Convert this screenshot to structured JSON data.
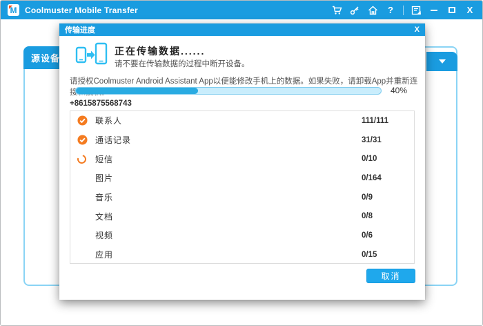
{
  "titlebar": {
    "logo_letter": "M",
    "app_title": "Coolmuster Mobile Transfer",
    "help_glyph": "?",
    "close_glyph": "X"
  },
  "background": {
    "source_device_label": "源设备："
  },
  "dialog": {
    "title": "传输进度",
    "close_glyph": "X",
    "heading": "正在传输数据......",
    "warning": "请不要在传输数据的过程中断开设备。",
    "auth_note": "请授权Coolmuster Android Assistant App以便能修改手机上的数据。如果失败，请卸载App并重新连接和授权。",
    "progress_percent": 40,
    "progress_label": "40%",
    "device_number": "+8615875568743",
    "transfer_items": [
      {
        "label": "联系人",
        "count": "111/111",
        "status": "done"
      },
      {
        "label": "通话记录",
        "count": "31/31",
        "status": "done"
      },
      {
        "label": "短信",
        "count": "0/10",
        "status": "in-progress"
      },
      {
        "label": "图片",
        "count": "0/164",
        "status": "pending"
      },
      {
        "label": "音乐",
        "count": "0/9",
        "status": "pending"
      },
      {
        "label": "文档",
        "count": "0/8",
        "status": "pending"
      },
      {
        "label": "视频",
        "count": "0/6",
        "status": "pending"
      },
      {
        "label": "应用",
        "count": "0/15",
        "status": "pending"
      }
    ],
    "cancel_label": "取消"
  },
  "colors": {
    "titlebar_blue": "#1a9ce0",
    "accent_blue": "#29abe2",
    "orange": "#f47b20",
    "panel_border": "#8ad4f5"
  }
}
